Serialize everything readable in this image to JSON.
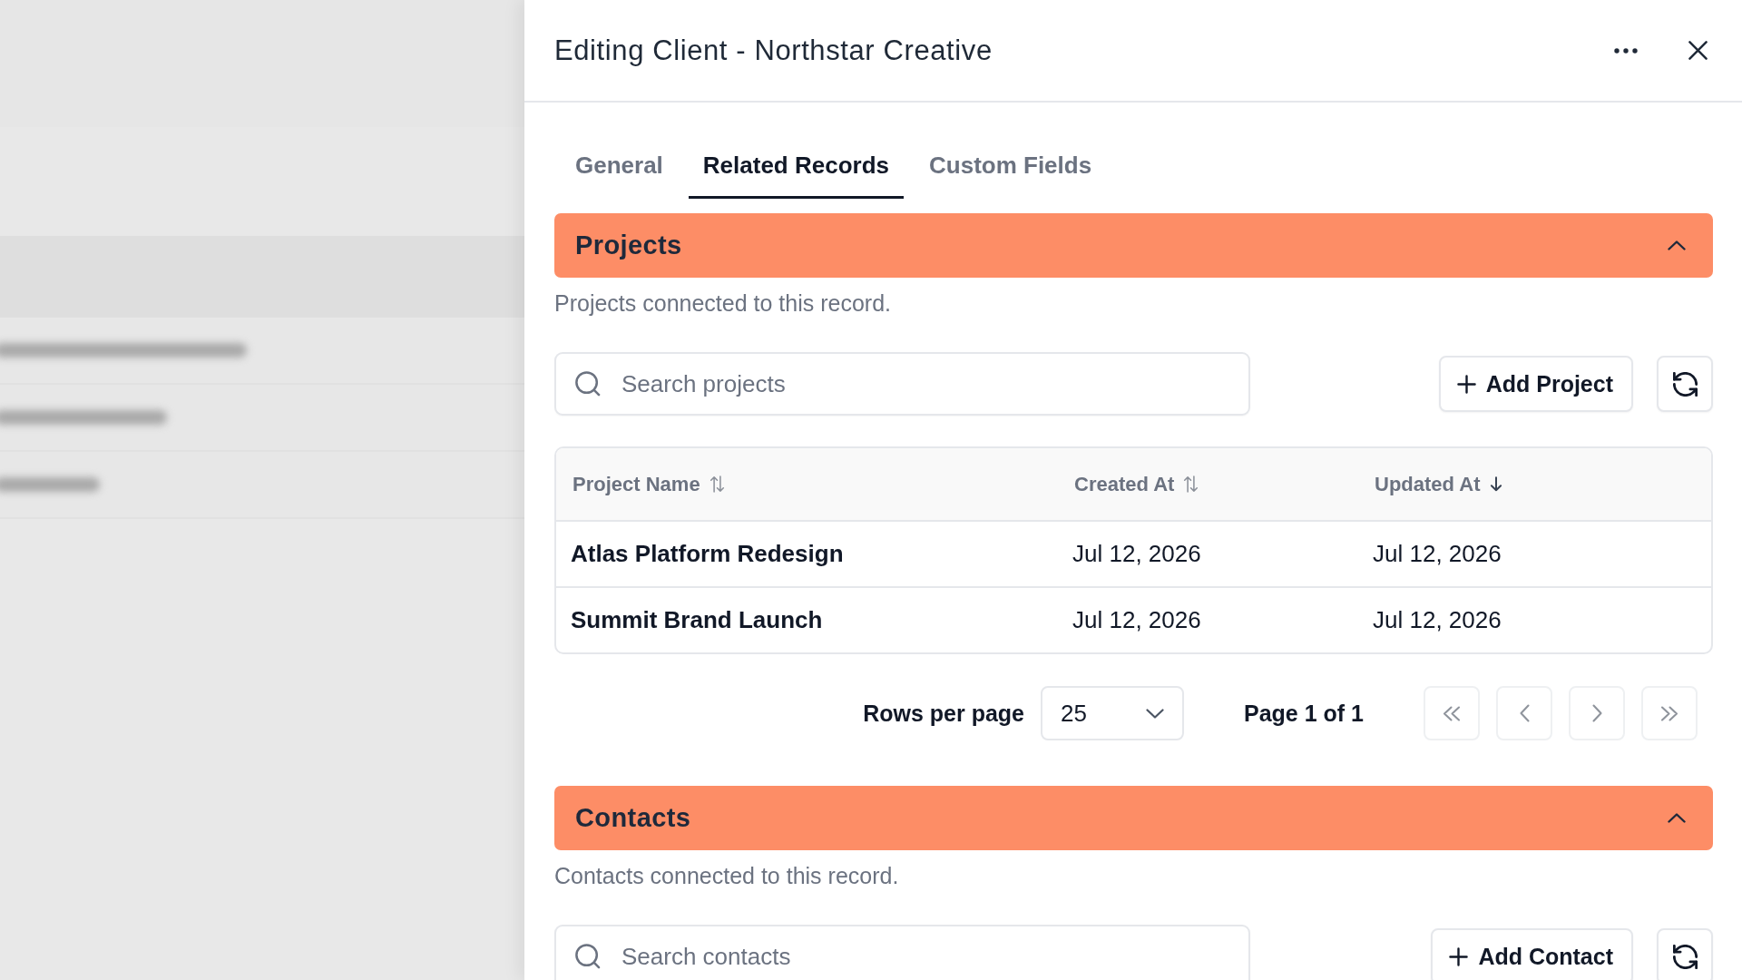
{
  "drawer": {
    "title": "Editing Client - Northstar Creative"
  },
  "tabs": [
    {
      "label": "General",
      "selected": false
    },
    {
      "label": "Related Records",
      "selected": true
    },
    {
      "label": "Custom Fields",
      "selected": false
    }
  ],
  "sections": [
    {
      "title": "Projects",
      "expanded": true,
      "description": "Projects connected to this record.",
      "search": {
        "placeholder": "Search projects"
      },
      "add_button": "Add Project",
      "table": {
        "columns": [
          {
            "label": "Project Name",
            "sorted": false
          },
          {
            "label": "Created At",
            "sorted": false
          },
          {
            "label": "Updated At",
            "sorted": true
          }
        ],
        "rows": [
          [
            "Atlas Platform Redesign",
            "Jul 12, 2026",
            "Jul 12, 2026"
          ],
          [
            "Summit Brand Launch",
            "Jul 12, 2026",
            "Jul 12, 2026"
          ]
        ]
      },
      "pagination": {
        "rows_per_page_label": "Rows per page",
        "rows_per_page": "25",
        "page_label": "Page 1 of 1",
        "buttons": [
          {
            "kind": "first",
            "disabled": true
          },
          {
            "kind": "previous",
            "disabled": true
          },
          {
            "kind": "next",
            "disabled": true
          },
          {
            "kind": "last",
            "disabled": true
          }
        ]
      }
    },
    {
      "title": "Contacts",
      "expanded": true,
      "description": "Contacts connected to this record.",
      "search": {
        "placeholder": "Search contacts"
      },
      "add_button": "Add Contact"
    }
  ]
}
